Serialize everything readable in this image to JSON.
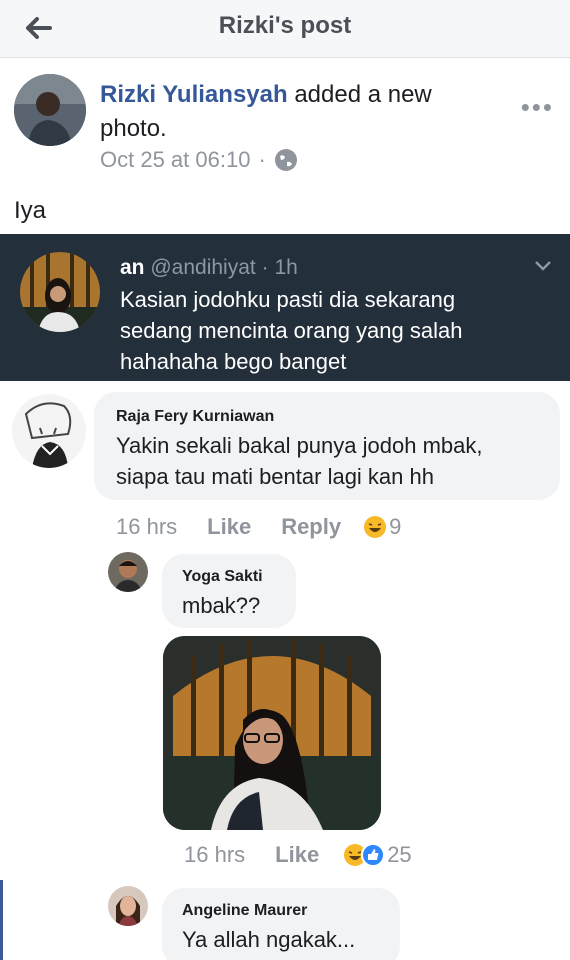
{
  "header": {
    "title": "Rizki's post"
  },
  "post": {
    "author": "Rizki Yuliansyah",
    "action": "added a new photo.",
    "timestamp": "Oct 25 at 06:10",
    "caption": "Iya"
  },
  "tweet": {
    "name": "an",
    "handle": "@andihiyat",
    "age": "1h",
    "lines": [
      "Kasian jodohku pasti dia sekarang",
      "sedang mencinta orang yang salah",
      "hahahaha bego banget"
    ]
  },
  "comments": [
    {
      "name": "Raja Fery Kurniawan",
      "lines": [
        "Yakin sekali bakal punya jodoh mbak,",
        "siapa tau mati bentar lagi kan hh"
      ],
      "time": "16 hrs",
      "like_label": "Like",
      "reply_label": "Reply",
      "reaction_count": "9"
    },
    {
      "name": "Yoga Sakti",
      "text": "mbak??",
      "time": "16 hrs",
      "like_label": "Like",
      "reaction_count": "25"
    },
    {
      "name": "Angeline Maurer",
      "text": "Ya allah ngakak..."
    }
  ],
  "colors": {
    "link": "#365899",
    "tweet_bg": "#232f3b",
    "bubble": "#f2f3f5",
    "meta": "#90949c"
  }
}
